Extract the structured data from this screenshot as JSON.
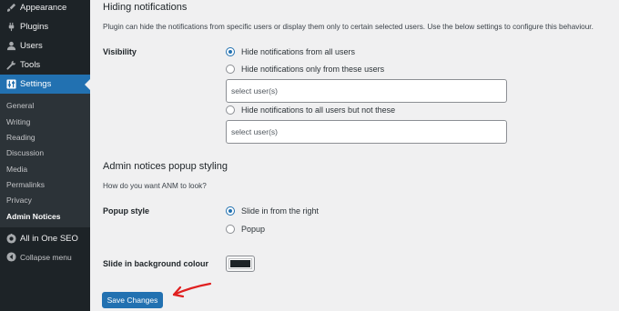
{
  "colors": {
    "accent": "#2271b1",
    "sidebar_bg": "#1d2327",
    "submenu_bg": "#2c3338",
    "annotation": "#e02020"
  },
  "sidebar": {
    "items": [
      {
        "label": "Appearance",
        "icon": "paintbrush-icon"
      },
      {
        "label": "Plugins",
        "icon": "plug-icon"
      },
      {
        "label": "Users",
        "icon": "user-icon"
      },
      {
        "label": "Tools",
        "icon": "wrench-icon"
      },
      {
        "label": "Settings",
        "icon": "settings-icon"
      }
    ],
    "submenu": [
      "General",
      "Writing",
      "Reading",
      "Discussion",
      "Media",
      "Permalinks",
      "Privacy",
      "Admin Notices"
    ],
    "aioseo": {
      "label": "All in One SEO",
      "icon": "aioseo-icon"
    },
    "collapse": {
      "label": "Collapse menu",
      "icon": "collapse-icon"
    }
  },
  "hiding": {
    "title": "Hiding notifications",
    "description": "Plugin can hide the notifications from specific users or display them only to certain selected users. Use the below settings to configure this behaviour.",
    "visibility_label": "Visibility",
    "options": [
      "Hide notifications from all users",
      "Hide notifications only from these users",
      "Hide notifications to all users but not these"
    ],
    "selected_index": 0,
    "select_placeholder_1": "select user(s)",
    "select_placeholder_2": "select user(s)"
  },
  "popup": {
    "title": "Admin notices popup styling",
    "description": "How do you want ANM to look?",
    "style_label": "Popup style",
    "options": [
      "Slide in from the right",
      "Popup"
    ],
    "selected_index": 0,
    "bg_label": "Slide in background colour",
    "bg_color": "#1d2327"
  },
  "save_label": "Save Changes"
}
